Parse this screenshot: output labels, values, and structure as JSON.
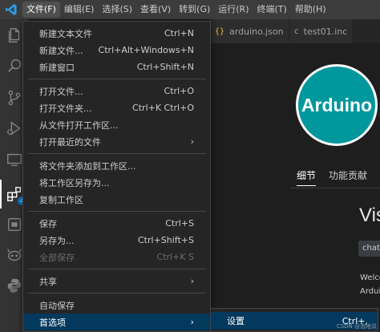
{
  "menubar": {
    "logo_icon": "vscode-logo-icon",
    "items": [
      {
        "label": "文件(F)",
        "active": true
      },
      {
        "label": "编辑(E)"
      },
      {
        "label": "选择(S)"
      },
      {
        "label": "查看(V)"
      },
      {
        "label": "转到(G)"
      },
      {
        "label": "运行(R)"
      },
      {
        "label": "终端(T)"
      },
      {
        "label": "帮助(H)"
      }
    ]
  },
  "activitybar": {
    "icons": [
      "explorer-icon",
      "search-icon",
      "source-control-icon",
      "run-debug-icon",
      "remote-explorer-icon",
      "extensions-icon",
      "arduino-board-icon",
      "copilot-icon",
      "python-icon"
    ],
    "extensions_badge": "4"
  },
  "tabs": [
    {
      "label": "arduino.json",
      "icon": "{}"
    },
    {
      "label": "test01.inc",
      "icon": "c"
    }
  ],
  "extension": {
    "logo_text": "Arduino",
    "detail_tabs": [
      "细节",
      "功能贡献"
    ],
    "title": "Vis",
    "pill": "chat",
    "body_lines": [
      "Welco",
      "Ardui"
    ]
  },
  "file_menu": {
    "groups": [
      [
        {
          "label": "新建文本文件",
          "shortcut": "Ctrl+N"
        },
        {
          "label": "新建文件...",
          "shortcut": "Ctrl+Alt+Windows+N"
        },
        {
          "label": "新建窗口",
          "shortcut": "Ctrl+Shift+N"
        }
      ],
      [
        {
          "label": "打开文件...",
          "shortcut": "Ctrl+O"
        },
        {
          "label": "打开文件夹...",
          "shortcut": "Ctrl+K Ctrl+O"
        },
        {
          "label": "从文件打开工作区...",
          "shortcut": ""
        },
        {
          "label": "打开最近的文件",
          "shortcut": "",
          "submenu": true
        }
      ],
      [
        {
          "label": "将文件夹添加到工作区...",
          "shortcut": ""
        },
        {
          "label": "将工作区另存为...",
          "shortcut": ""
        },
        {
          "label": "复制工作区",
          "shortcut": ""
        }
      ],
      [
        {
          "label": "保存",
          "shortcut": "Ctrl+S"
        },
        {
          "label": "另存为...",
          "shortcut": "Ctrl+Shift+S"
        },
        {
          "label": "全部保存",
          "shortcut": "Ctrl+K S",
          "disabled": true
        }
      ],
      [
        {
          "label": "共享",
          "shortcut": "",
          "submenu": true
        }
      ],
      [
        {
          "label": "自动保存",
          "shortcut": ""
        },
        {
          "label": "首选项",
          "shortcut": "",
          "submenu": true,
          "highlight": true
        }
      ]
    ]
  },
  "submenu": {
    "label": "设置",
    "shortcut": "Ctrl+,"
  },
  "watermark": "CSDN @泡地瓜"
}
